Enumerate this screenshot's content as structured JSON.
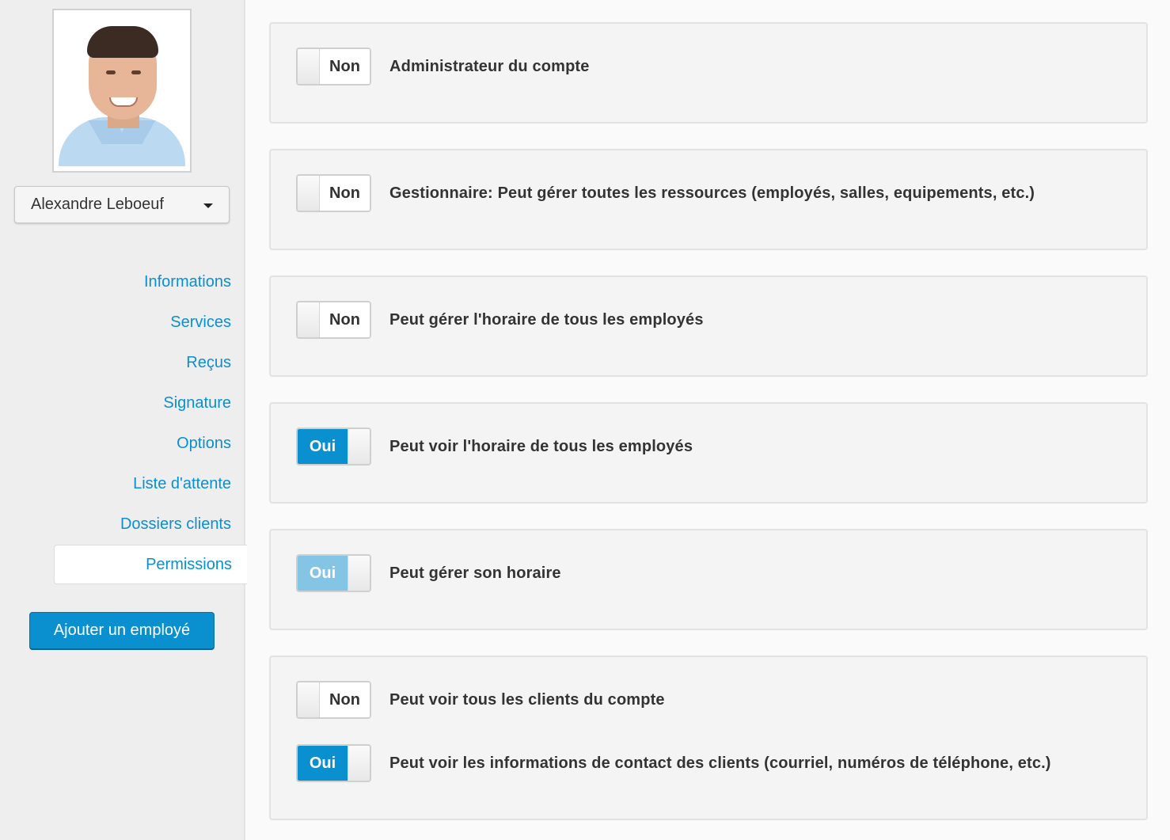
{
  "sidebar": {
    "employee": {
      "name": "Alexandre Leboeuf",
      "photo_alt": "Employee photo"
    },
    "nav_items": [
      {
        "label": "Informations",
        "active": false
      },
      {
        "label": "Services",
        "active": false
      },
      {
        "label": "Reçus",
        "active": false
      },
      {
        "label": "Signature",
        "active": false
      },
      {
        "label": "Options",
        "active": false
      },
      {
        "label": "Liste d'attente",
        "active": false
      },
      {
        "label": "Dossiers clients",
        "active": false
      },
      {
        "label": "Permissions",
        "active": true
      }
    ],
    "add_employee_label": "Ajouter un employé"
  },
  "permissions": {
    "groups": [
      {
        "items": [
          {
            "state": "Non",
            "enabled": false,
            "disabled": false,
            "label": "Administrateur du compte"
          }
        ]
      },
      {
        "items": [
          {
            "state": "Non",
            "enabled": false,
            "disabled": false,
            "label": "Gestionnaire: Peut gérer toutes les ressources (employés, salles, equipements, etc.)"
          }
        ]
      },
      {
        "items": [
          {
            "state": "Non",
            "enabled": false,
            "disabled": false,
            "label": "Peut gérer l'horaire de tous les employés"
          }
        ]
      },
      {
        "items": [
          {
            "state": "Oui",
            "enabled": true,
            "disabled": false,
            "label": "Peut voir l'horaire de tous les employés"
          }
        ]
      },
      {
        "items": [
          {
            "state": "Oui",
            "enabled": true,
            "disabled": true,
            "label": "Peut gérer son horaire"
          }
        ]
      },
      {
        "items": [
          {
            "state": "Non",
            "enabled": false,
            "disabled": false,
            "label": "Peut voir tous les clients du compte"
          },
          {
            "state": "Oui",
            "enabled": true,
            "disabled": false,
            "label": "Peut voir les informations de contact des clients (courriel, numéros de téléphone, etc.)"
          }
        ]
      }
    ]
  },
  "colors": {
    "accent": "#0a8fcf",
    "accent_disabled": "#84c5e6",
    "sidebar_bg": "#eeeeee",
    "card_bg": "#f4f4f4"
  }
}
